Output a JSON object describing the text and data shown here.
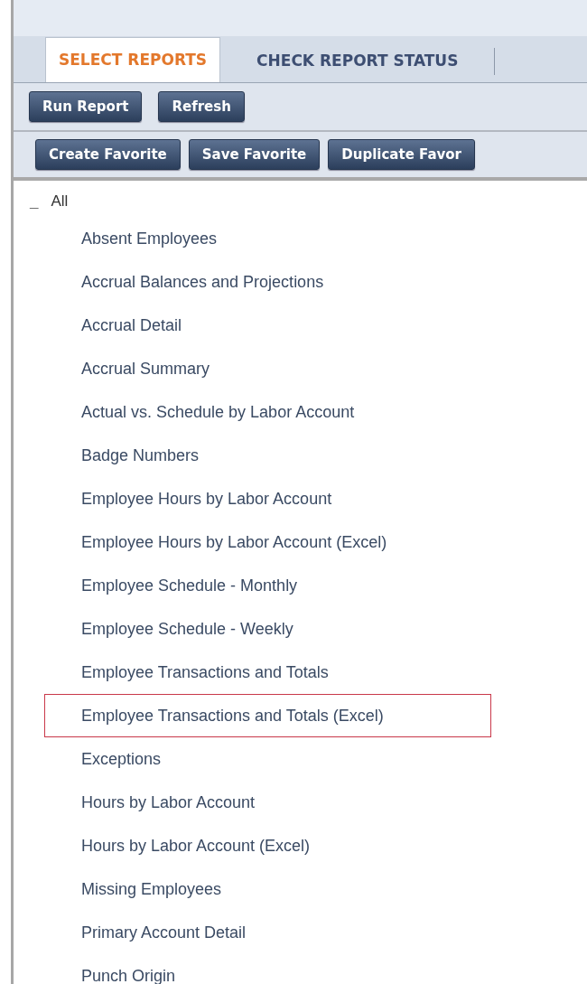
{
  "tabs": [
    {
      "label": "SELECT REPORTS",
      "selected": true
    },
    {
      "label": "CHECK REPORT STATUS",
      "selected": false
    }
  ],
  "toolbar_1": [
    "Run Report",
    "Refresh"
  ],
  "toolbar_2": [
    "Create Favorite",
    "Save Favorite",
    "Duplicate Favor"
  ],
  "tree": {
    "label": "All",
    "toggle": "_",
    "expanded": true,
    "children": [
      {
        "label": "Absent Employees",
        "highlighted": false
      },
      {
        "label": "Accrual Balances and Projections",
        "highlighted": false
      },
      {
        "label": "Accrual Detail",
        "highlighted": false
      },
      {
        "label": "Accrual Summary",
        "highlighted": false
      },
      {
        "label": "Actual vs. Schedule by Labor Account",
        "highlighted": false
      },
      {
        "label": "Badge Numbers",
        "highlighted": false
      },
      {
        "label": "Employee Hours by Labor Account",
        "highlighted": false
      },
      {
        "label": "Employee Hours by Labor Account (Excel)",
        "highlighted": false
      },
      {
        "label": "Employee Schedule - Monthly",
        "highlighted": false
      },
      {
        "label": "Employee Schedule - Weekly",
        "highlighted": false
      },
      {
        "label": "Employee Transactions and Totals",
        "highlighted": false
      },
      {
        "label": "Employee Transactions and Totals (Excel)",
        "highlighted": true
      },
      {
        "label": "Exceptions",
        "highlighted": false
      },
      {
        "label": "Hours by Labor Account",
        "highlighted": false
      },
      {
        "label": "Hours by Labor Account (Excel)",
        "highlighted": false
      },
      {
        "label": "Missing Employees",
        "highlighted": false
      },
      {
        "label": "Primary Account Detail",
        "highlighted": false
      },
      {
        "label": "Punch Origin",
        "highlighted": false
      }
    ]
  }
}
